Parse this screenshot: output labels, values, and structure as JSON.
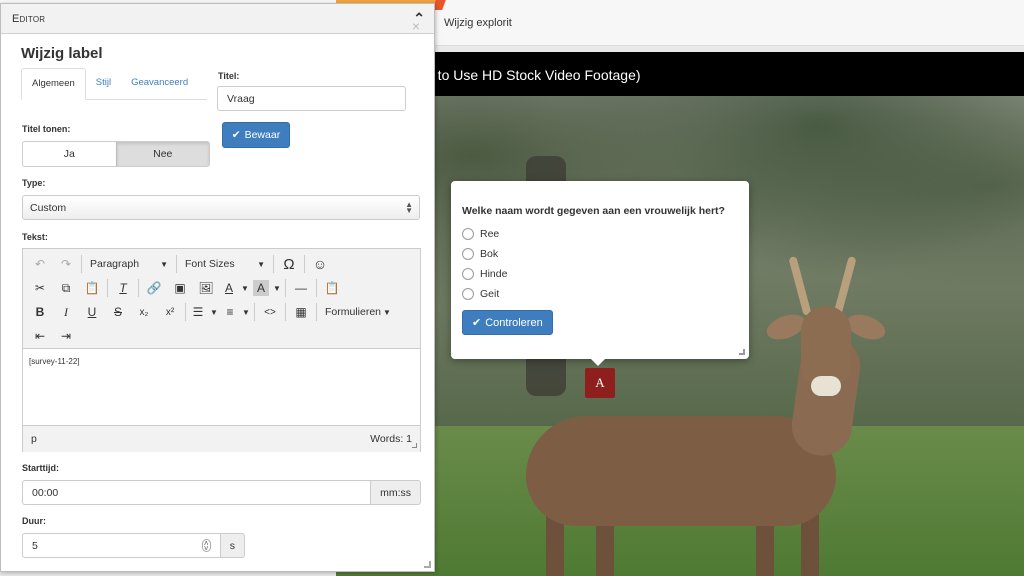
{
  "app": {
    "nav_link": "Wijzig explorit"
  },
  "video": {
    "title": "e to Use HD Stock Video Footage)"
  },
  "popover": {
    "question": "Welke naam wordt gegeven aan een vrouwelijk hert?",
    "options": [
      "Ree",
      "Bok",
      "Hinde",
      "Geit"
    ],
    "check_label": "Controleren"
  },
  "marker": {
    "letter": "A",
    "color": "#8e1f1c"
  },
  "editor": {
    "header_title": "Editor",
    "dialog_title": "Wijzig label",
    "tabs": [
      "Algemeen",
      "Stijl",
      "Geavanceerd"
    ],
    "title_label": "Titel:",
    "title_value": "Vraag",
    "save_label": "Bewaar",
    "show_title_label": "Titel tonen:",
    "show_title_options": [
      "Ja",
      "Nee"
    ],
    "type_label": "Type:",
    "type_value": "Custom",
    "text_label": "Tekst:",
    "toolbar": {
      "paragraph": "Paragraph",
      "font_sizes": "Font Sizes",
      "forms": "Formulieren"
    },
    "content": "[survey-11-22]",
    "status_path": "p",
    "word_count": "Words: 1",
    "start_label": "Starttijd:",
    "start_value": "00:00",
    "start_unit": "mm:ss",
    "duration_label": "Duur:",
    "duration_value": "5",
    "duration_unit": "s"
  },
  "colors": {
    "primary": "#3e7ebf",
    "accent_orange": "#f4a23a"
  }
}
